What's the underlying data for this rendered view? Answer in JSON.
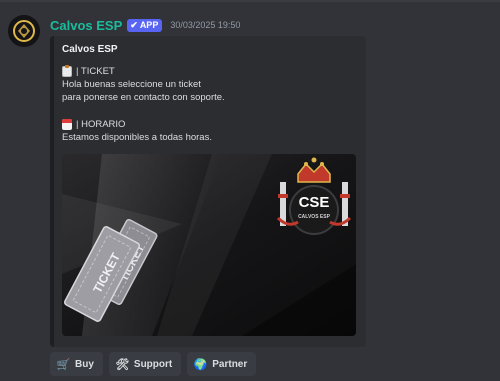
{
  "message": {
    "username": "Calvos ESP",
    "badge": "APP",
    "badge_check": "✔",
    "timestamp": "30/03/2025 19:50"
  },
  "embed": {
    "title": "Calvos ESP",
    "sections": [
      {
        "icon": "clipboard-icon",
        "heading": "| TICKET",
        "lines": [
          "Hola buenas seleccione un ticket",
          "para ponerse en contacto con soporte."
        ]
      },
      {
        "icon": "calendar-icon",
        "heading": "| HORARIO",
        "lines": [
          "Estamos disponibles a todas horas."
        ]
      }
    ],
    "banner": {
      "ticket_text": "TICKET",
      "ticket_text_back": "TICKET",
      "logo_text": "CSE",
      "logo_subtext": "CALVOS ESP"
    }
  },
  "buttons": [
    {
      "label": "Buy",
      "icon": "cart-icon",
      "emoji": "🛒"
    },
    {
      "label": "Support",
      "icon": "tools-icon",
      "emoji": "🛠"
    },
    {
      "label": "Partner",
      "icon": "globe-icon",
      "emoji": "🌍"
    }
  ],
  "colors": {
    "background": "#323339",
    "username": "#1abc9c",
    "badge": "#5865f2",
    "embed_bg": "#2b2d31",
    "button_bg": "#3a3c43"
  }
}
